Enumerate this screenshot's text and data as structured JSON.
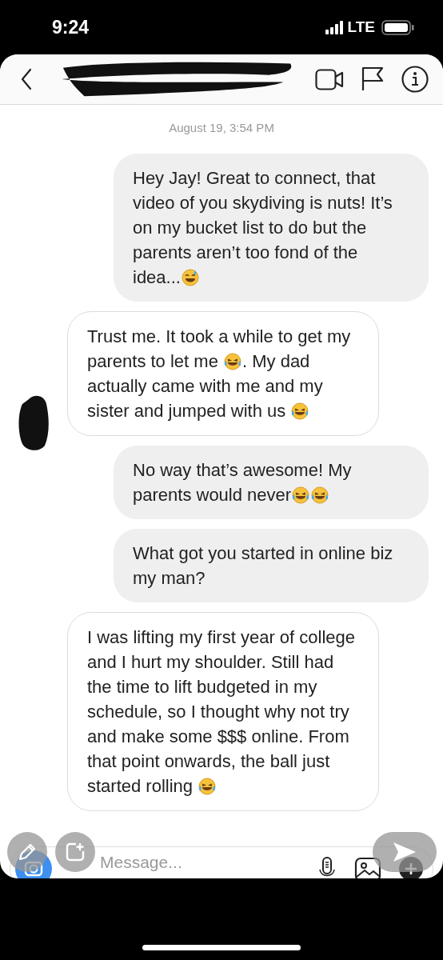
{
  "status_bar": {
    "time": "9:24",
    "network": "LTE"
  },
  "timestamp": "August 19, 3:54 PM",
  "messages": [
    {
      "kind": "sent",
      "parts": [
        {
          "kind": "text",
          "text": "Hey Jay! Great to connect, that video of you skydiving is nuts! It’s on my bucket list to do but the parents aren’t too fond of the idea..."
        },
        {
          "kind": "sweating"
        }
      ]
    },
    {
      "kind": "received",
      "parts": [
        {
          "kind": "text",
          "text": "Trust me. It took a while to get my parents to let me "
        },
        {
          "kind": "laughing"
        },
        {
          "kind": "text",
          "text": ". My dad actually came with me and my sister and jumped with us "
        },
        {
          "kind": "laughing"
        }
      ]
    },
    {
      "kind": "sent",
      "parts": [
        {
          "kind": "text",
          "text": "No way that’s awesome! My parents would never"
        },
        {
          "kind": "laughing"
        },
        {
          "kind": "laughing"
        }
      ]
    },
    {
      "kind": "sent",
      "parts": [
        {
          "kind": "text",
          "text": "What got you started in online biz my man?"
        }
      ]
    },
    {
      "kind": "received",
      "parts": [
        {
          "kind": "text",
          "text": "I was lifting my first year of college and I hurt my shoulder. Still had the time to lift budgeted in my schedule, so I thought why not try and make some $$$ online. From that point onwards, the ball just started rolling "
        },
        {
          "kind": "laughing"
        }
      ]
    }
  ],
  "composer": {
    "placeholder": "Message..."
  }
}
